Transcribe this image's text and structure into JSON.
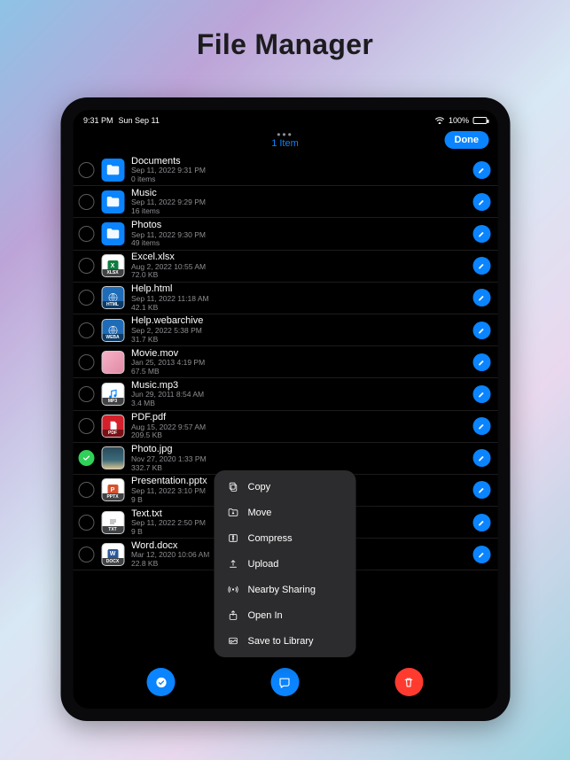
{
  "pageTitle": "File Manager",
  "statusBar": {
    "time": "9:31 PM",
    "date": "Sun Sep 11",
    "battery": "100%"
  },
  "navBar": {
    "itemCount": "1 Item",
    "doneLabel": "Done"
  },
  "files": [
    {
      "name": "Documents",
      "date": "Sep 11, 2022 9:31 PM",
      "size": "0 items",
      "type": "folder",
      "selected": false
    },
    {
      "name": "Music",
      "date": "Sep 11, 2022 9:29 PM",
      "size": "16 items",
      "type": "folder",
      "selected": false
    },
    {
      "name": "Photos",
      "date": "Sep 11, 2022 9:30 PM",
      "size": "49 items",
      "type": "folder",
      "selected": false
    },
    {
      "name": "Excel.xlsx",
      "date": "Aug 2, 2022 10:55 AM",
      "size": "72.0 KB",
      "type": "xlsx",
      "selected": false
    },
    {
      "name": "Help.html",
      "date": "Sep 11, 2022 11:18 AM",
      "size": "42.1 KB",
      "type": "html",
      "selected": false
    },
    {
      "name": "Help.webarchive",
      "date": "Sep 2, 2022 5:38 PM",
      "size": "31.7 KB",
      "type": "weba",
      "selected": false
    },
    {
      "name": "Movie.mov",
      "date": "Jan 25, 2013 4:19 PM",
      "size": "67.5 MB",
      "type": "mov",
      "selected": false
    },
    {
      "name": "Music.mp3",
      "date": "Jun 29, 2011 8:54 AM",
      "size": "3.4 MB",
      "type": "mp3",
      "selected": false
    },
    {
      "name": "PDF.pdf",
      "date": "Aug 15, 2022 9:57 AM",
      "size": "209.5 KB",
      "type": "pdf",
      "selected": false
    },
    {
      "name": "Photo.jpg",
      "date": "Nov 27, 2020 1:33 PM",
      "size": "332.7 KB",
      "type": "jpg",
      "selected": true
    },
    {
      "name": "Presentation.pptx",
      "date": "Sep 11, 2022 3:10 PM",
      "size": "9 B",
      "type": "pptx",
      "selected": false
    },
    {
      "name": "Text.txt",
      "date": "Sep 11, 2022 2:50 PM",
      "size": "9 B",
      "type": "txt",
      "selected": false
    },
    {
      "name": "Word.docx",
      "date": "Mar 12, 2020 10:06 AM",
      "size": "22.8 KB",
      "type": "docx",
      "selected": false
    }
  ],
  "contextMenu": {
    "items": [
      {
        "label": "Copy",
        "icon": "copy"
      },
      {
        "label": "Move",
        "icon": "move"
      },
      {
        "label": "Compress",
        "icon": "compress"
      },
      {
        "label": "Upload",
        "icon": "upload"
      },
      {
        "label": "Nearby Sharing",
        "icon": "nearby"
      },
      {
        "label": "Open In",
        "icon": "openin"
      },
      {
        "label": "Save to Library",
        "icon": "save"
      }
    ]
  },
  "thumbStyles": {
    "xlsx": {
      "bg": "#ffffff",
      "badgeBg": "#404244",
      "badgeText": "XLSX",
      "inner": "#107c41"
    },
    "html": {
      "bg": "#1e6bb8",
      "badgeBg": "#0d3a66",
      "badgeText": "HTML",
      "inner": "#ffffff"
    },
    "weba": {
      "bg": "#1e6bb8",
      "badgeBg": "#0d3a66",
      "badgeText": "WEBA",
      "inner": "#ffffff"
    },
    "mov": {
      "bg": "linear-gradient(135deg,#f7b3c9,#e08aa5)",
      "badgeBg": "",
      "badgeText": "",
      "inner": ""
    },
    "mp3": {
      "bg": "#ffffff",
      "badgeBg": "#404244",
      "badgeText": "MP3",
      "inner": "#0a84ff"
    },
    "pdf": {
      "bg": "#d4202a",
      "badgeBg": "#7a0f15",
      "badgeText": "PDF",
      "inner": "#ffffff"
    },
    "jpg": {
      "bg": "linear-gradient(180deg,#2a4a5a 0%,#3a6a7a 60%,#d4c08a 100%)",
      "badgeBg": "",
      "badgeText": "",
      "inner": ""
    },
    "pptx": {
      "bg": "#ffffff",
      "badgeBg": "#404244",
      "badgeText": "PPTX",
      "inner": "#d35230"
    },
    "txt": {
      "bg": "#ffffff",
      "badgeBg": "#404244",
      "badgeText": "TXT",
      "inner": "#8e8e93"
    },
    "docx": {
      "bg": "#ffffff",
      "badgeBg": "#404244",
      "badgeText": "DOCX",
      "inner": "#2b579a"
    }
  }
}
